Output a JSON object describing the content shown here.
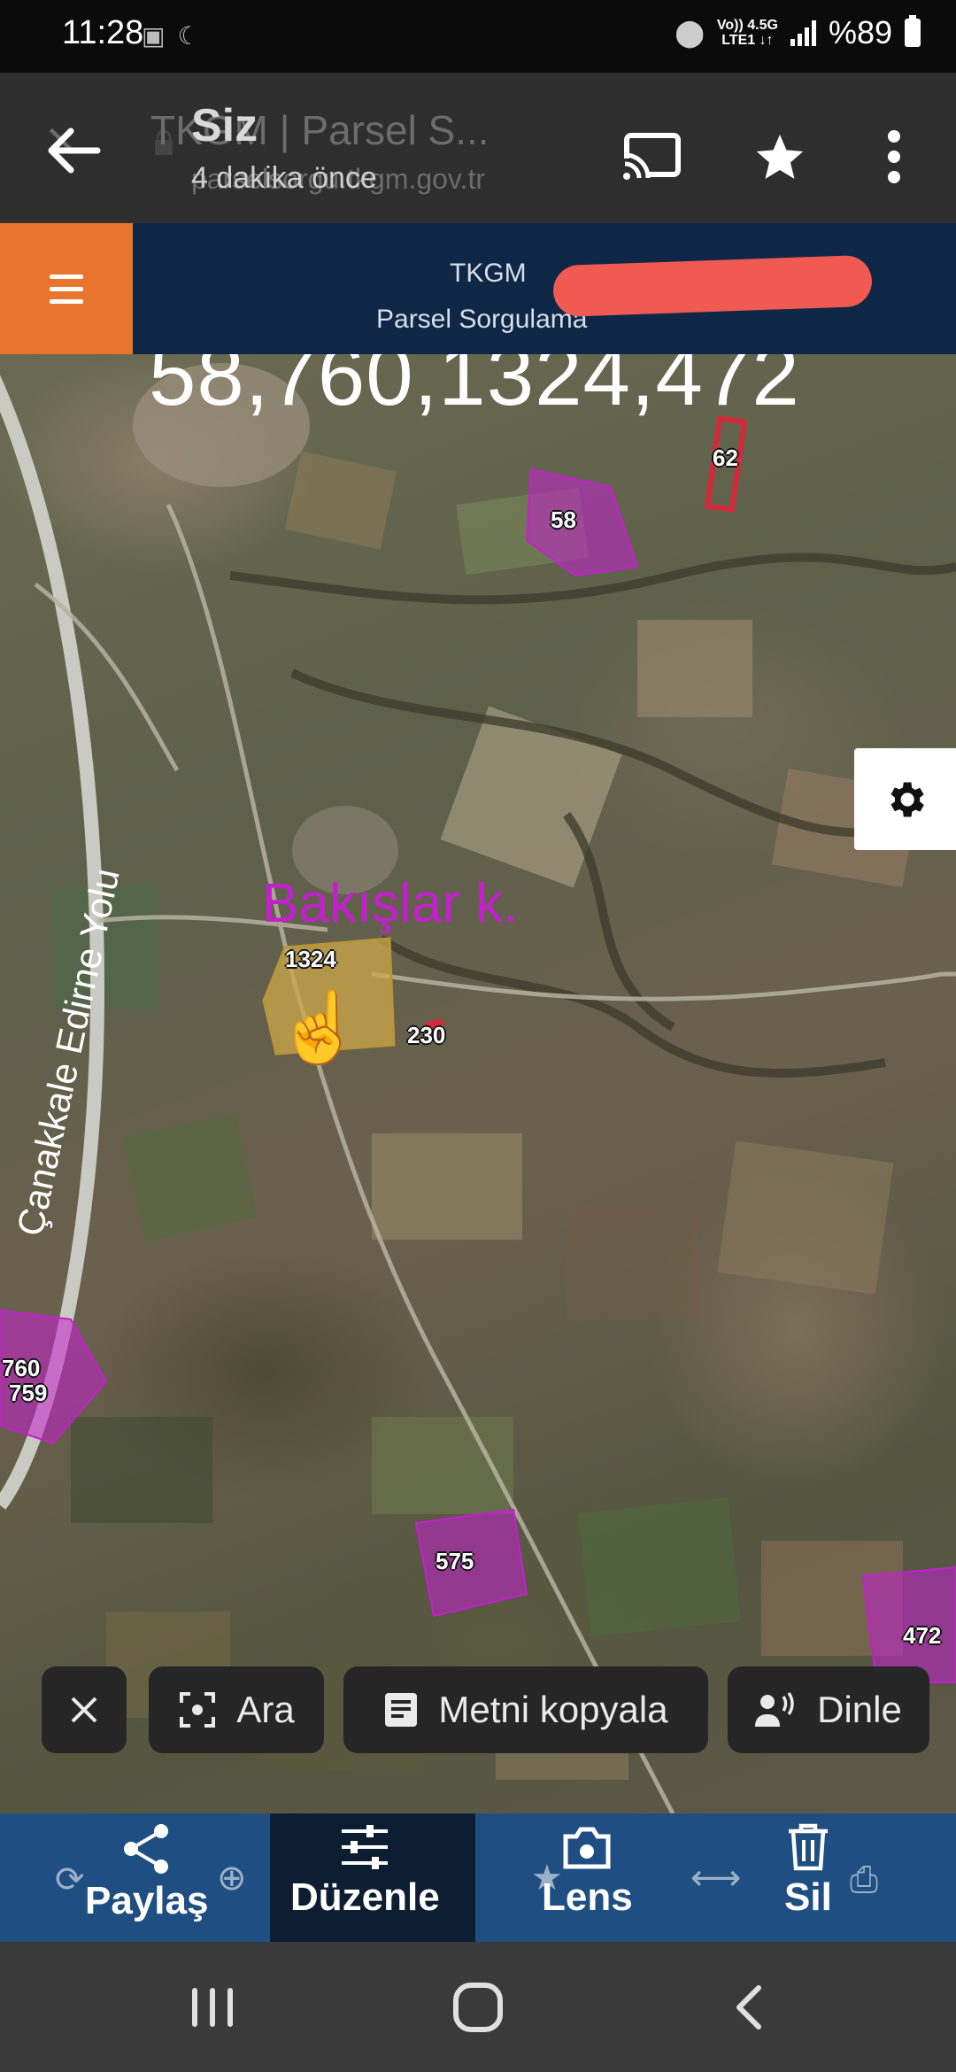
{
  "status_bar": {
    "time": "11:28",
    "network_top": "Vo)) 4.5G",
    "network_bottom": "LTE1 ↓↑",
    "battery": "%89"
  },
  "toolbar": {
    "title": "Siz",
    "subtitle": "4 dakika önce",
    "background_title": "TKGM | Parsel S...",
    "background_url": "parselsorgu.tkgm.gov.tr",
    "icons": [
      "back-arrow-icon",
      "cast-icon",
      "star-icon",
      "more-vert-icon"
    ]
  },
  "site": {
    "brand": "TKGM",
    "subtitle": "Parsel Sorgulama"
  },
  "map": {
    "annotation_numbers": "58,760,1324,472",
    "road_label": "Çanakkale Edirne Yolu",
    "village_label": "Bakışlar k.",
    "parcels": [
      {
        "label": "62"
      },
      {
        "label": "58"
      },
      {
        "label": "1324"
      },
      {
        "label": "230"
      },
      {
        "label": "760"
      },
      {
        "label": "759"
      },
      {
        "label": "575"
      },
      {
        "label": "472"
      }
    ],
    "pointer_emoji": "☝️"
  },
  "chips": {
    "close_icon": "close-icon",
    "search_label": "Ara",
    "copy_label": "Metni kopyala",
    "listen_label": "Dinle"
  },
  "bottom_bar": {
    "share_label": "Paylaş",
    "edit_label": "Düzenle",
    "lens_label": "Lens",
    "delete_label": "Sil"
  },
  "colors": {
    "header_bg": "#0f2747",
    "menu_orange": "#e9742c",
    "parcel_magenta": "#c41fcf",
    "bottom_bar_bg": "#1f4f82"
  }
}
